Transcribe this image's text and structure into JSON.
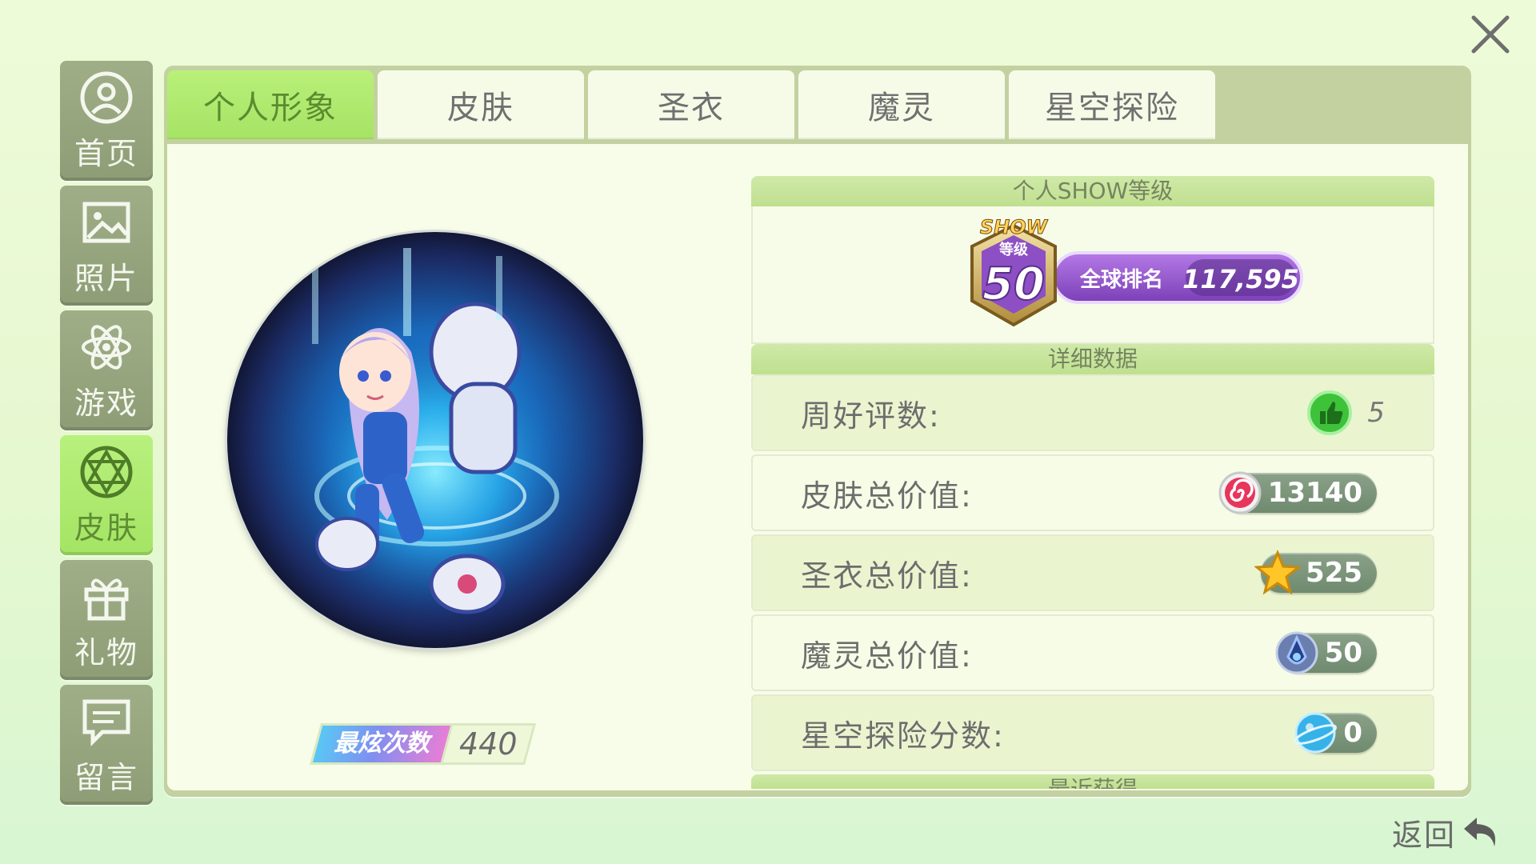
{
  "sidebar": {
    "items": [
      {
        "label": "首页",
        "icon": "person-icon",
        "active": false
      },
      {
        "label": "照片",
        "icon": "photo-icon",
        "active": false
      },
      {
        "label": "游戏",
        "icon": "atom-icon",
        "active": false
      },
      {
        "label": "皮肤",
        "icon": "hexagram-icon",
        "active": true
      },
      {
        "label": "礼物",
        "icon": "gift-icon",
        "active": false
      },
      {
        "label": "留言",
        "icon": "message-icon",
        "active": false
      }
    ]
  },
  "tabs": [
    "个人形象",
    "皮肤",
    "圣衣",
    "魔灵",
    "星空探险"
  ],
  "avatar": {
    "count_label": "最炫次数",
    "count_value": "440"
  },
  "show_level": {
    "header": "个人SHOW等级",
    "badge_top": "SHOW",
    "badge_sub": "等级",
    "level": "50",
    "rank_label": "全球排名",
    "rank_value": "117,595"
  },
  "details": {
    "header": "详细数据",
    "rows": [
      {
        "label": "周好评数:",
        "value": "5",
        "icon": "thumbs-up-icon"
      },
      {
        "label": "皮肤总价值:",
        "value": "13140",
        "icon": "candy-swirl-icon"
      },
      {
        "label": "圣衣总价值:",
        "value": "525",
        "icon": "star-icon"
      },
      {
        "label": "魔灵总价值:",
        "value": "50",
        "icon": "spirit-gem-icon"
      },
      {
        "label": "星空探险分数:",
        "value": "0",
        "icon": "planet-icon"
      }
    ]
  },
  "recent_header": "最近获得",
  "back_label": "返回",
  "colors": {
    "active_green": "#a6e364",
    "sidebar_gray": "#8e9d76",
    "show_purple": "#8a4fbf"
  }
}
